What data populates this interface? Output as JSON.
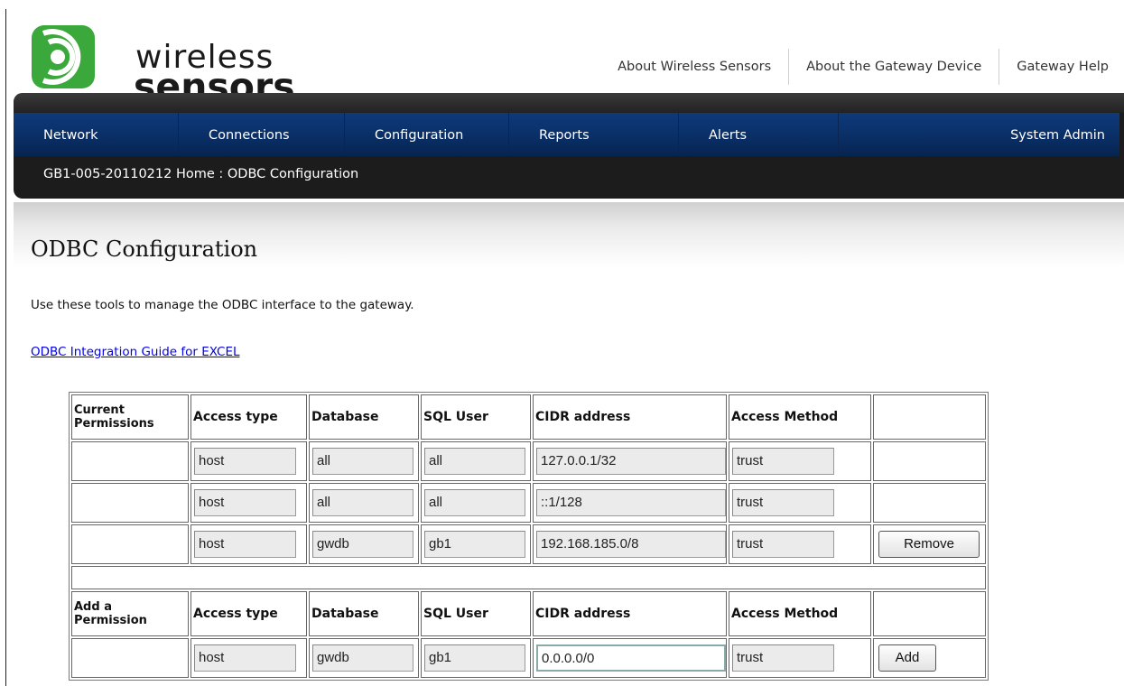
{
  "brand": {
    "line1": "wireless",
    "line2": "sensors",
    "logo_color": "#3aa83a"
  },
  "top_links": [
    "About Wireless Sensors",
    "About the Gateway Device",
    "Gateway Help"
  ],
  "menu": [
    "Network",
    "Connections",
    "Configuration",
    "Reports",
    "Alerts",
    "System Admin"
  ],
  "breadcrumb": "GB1-005-20110212 Home : ODBC Configuration",
  "page": {
    "title": "ODBC Configuration",
    "description": "Use these tools to manage the ODBC interface to the gateway.",
    "guide_link": "ODBC Integration Guide for EXCEL"
  },
  "table": {
    "current_header": {
      "label_line1": "Current",
      "label_line2": "Permissions",
      "cols": [
        "Access type",
        "Database",
        "SQL User",
        "CIDR address",
        "Access Method"
      ]
    },
    "current_rows": [
      {
        "access_type": "host",
        "database": "all",
        "sql_user": "all",
        "cidr": "127.0.0.1/32",
        "method": "trust",
        "action": ""
      },
      {
        "access_type": "host",
        "database": "all",
        "sql_user": "all",
        "cidr": "::1/128",
        "method": "trust",
        "action": ""
      },
      {
        "access_type": "host",
        "database": "gwdb",
        "sql_user": "gb1",
        "cidr": "192.168.185.0/8",
        "method": "trust",
        "action": "Remove"
      }
    ],
    "add_header": {
      "label_line1": "Add a",
      "label_line2": "Permission",
      "cols": [
        "Access type",
        "Database",
        "SQL User",
        "CIDR address",
        "Access Method"
      ]
    },
    "add_row": {
      "access_type": "host",
      "database": "gwdb",
      "sql_user": "gb1",
      "cidr": "0.0.0.0/0",
      "method": "trust",
      "action": "Add"
    }
  }
}
